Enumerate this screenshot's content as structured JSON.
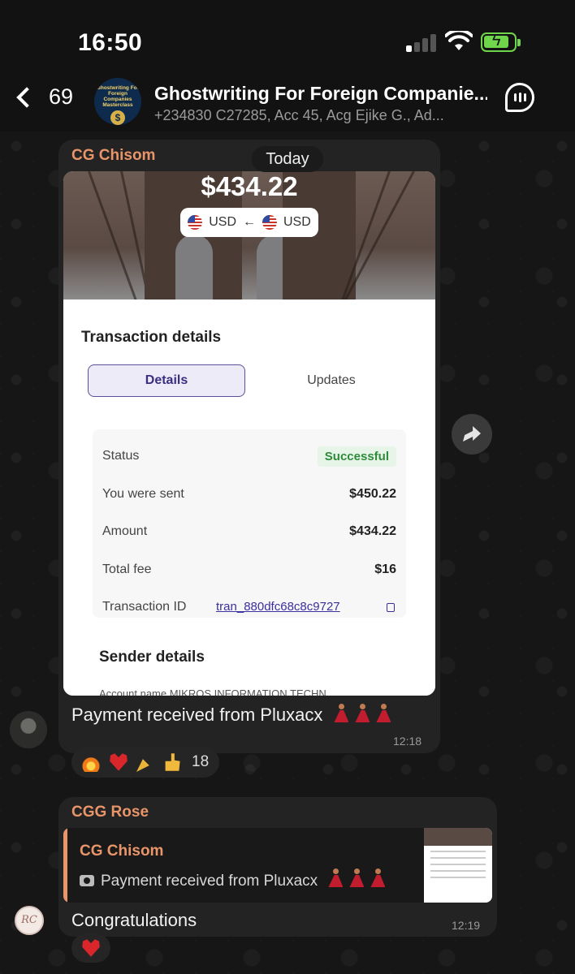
{
  "status_bar": {
    "time": "16:50"
  },
  "header": {
    "back_count": "69",
    "title": "Ghostwriting For Foreign Companie...",
    "subtitle": "+234830 C27285, Acc 45, Acg Ejike G., Ad...",
    "avatar_text": "Ghostwriting For Foreign Companies Masterclass"
  },
  "date_chip": "Today",
  "message1": {
    "sender": "CG Chisom",
    "media": {
      "amount_header": "$434.22",
      "currency_from": "USD",
      "currency_to": "USD",
      "card_title": "Transaction details",
      "tabs": [
        "Details",
        "Updates"
      ],
      "rows": [
        {
          "label": "Status",
          "value": "Successful"
        },
        {
          "label": "You were sent",
          "value": "$450.22"
        },
        {
          "label": "Amount",
          "value": "$434.22"
        },
        {
          "label": "Total fee",
          "value": "$16"
        },
        {
          "label": "Transaction ID",
          "value": "tran_880dfc68c8c9727"
        }
      ],
      "sender_details_title": "Sender details",
      "cut_text": "Account name    MIKROS INFORMATION TECHN"
    },
    "text": "Payment received from Pluxacx",
    "time": "12:18",
    "reactions": {
      "count": "18",
      "emojis": [
        "fire",
        "heart",
        "party-popper",
        "thumbs-up"
      ]
    }
  },
  "message2": {
    "sender": "CGG Rose",
    "quote": {
      "sender": "CG Chisom",
      "text": "Payment received from Pluxacx"
    },
    "text": "Congratulations",
    "time": "12:19",
    "avatar_initials": "RC",
    "reactions": {
      "emojis": [
        "heart"
      ]
    }
  },
  "colors": {
    "accent_sender": "#e9956a",
    "status_success": "#2f8a3a",
    "battery": "#6fd64b"
  }
}
